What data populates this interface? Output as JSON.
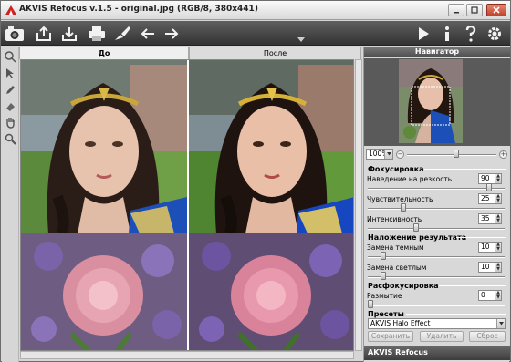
{
  "window": {
    "title": "AKVIS Refocus v.1.5 - original.jpg (RGB/8, 380x441)"
  },
  "toolbar": {
    "items": [
      {
        "name": "camera-icon"
      },
      {
        "name": "open-icon"
      },
      {
        "name": "save-icon"
      },
      {
        "name": "print-icon"
      },
      {
        "name": "brush-icon"
      },
      {
        "name": "undo-icon"
      },
      {
        "name": "redo-icon"
      },
      {
        "name": "run-icon"
      },
      {
        "name": "info-icon"
      },
      {
        "name": "help-icon"
      },
      {
        "name": "settings-icon"
      }
    ]
  },
  "tabs": {
    "before": "До",
    "after": "После"
  },
  "navigator": {
    "title": "Навигатор",
    "zoom": "100%",
    "zoom_minus": "−",
    "zoom_plus": "+",
    "zoom_level": 0.55
  },
  "focus": {
    "title": "Фокусировка",
    "sharpness_label": "Наведение на резкость",
    "sharpness_value": "90",
    "sharpness_level": 0.9,
    "sensitivity_label": "Чувствительность",
    "sensitivity_value": "25",
    "sensitivity_level": 0.25,
    "intensity_label": "Интенсивность",
    "intensity_value": "35",
    "intensity_level": 0.35
  },
  "blend": {
    "title": "Наложение результата",
    "dark_label": "Замена темным",
    "dark_value": "10",
    "dark_level": 0.1,
    "light_label": "Замена светлым",
    "light_value": "10",
    "light_level": 0.1
  },
  "defocus": {
    "title": "Расфокусировка",
    "blur_label": "Размытие",
    "blur_value": "0",
    "blur_level": 0
  },
  "presets": {
    "title": "Пресеты",
    "selected": "AKVIS Halo Effect",
    "save": "Сохранить",
    "delete": "Удалить",
    "reset": "Сброс"
  },
  "brand": "AKVIS Refocus",
  "colors": {
    "toolbar": "#444444",
    "panel_header": "#5a5a5a",
    "accent": "#3a6fd8"
  }
}
